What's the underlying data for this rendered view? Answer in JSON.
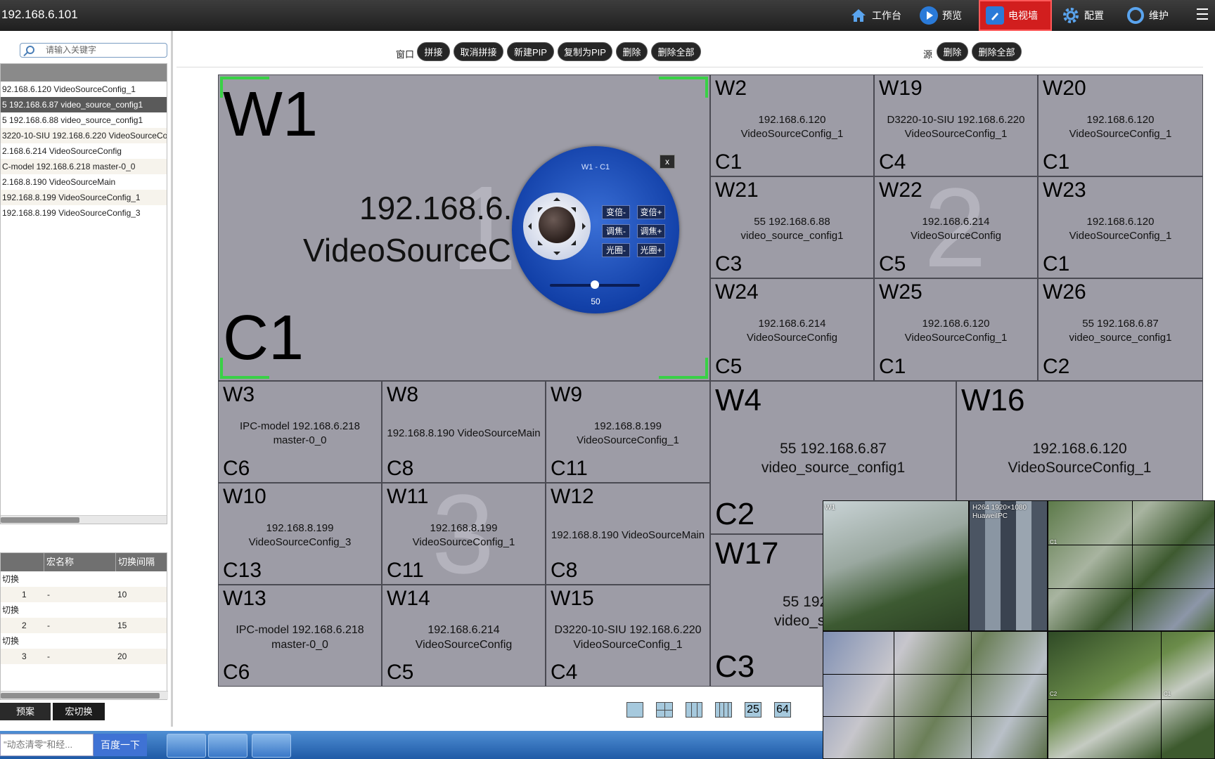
{
  "topbar": {
    "ip": "192.168.6.101",
    "nav": [
      {
        "label": "工作台",
        "icon": "home-icon"
      },
      {
        "label": "预览",
        "icon": "play-icon"
      },
      {
        "label": "电视墙",
        "icon": "tv-wall-icon",
        "active": true
      },
      {
        "label": "配置",
        "icon": "gear-icon"
      },
      {
        "label": "维护",
        "icon": "maintenance-icon"
      }
    ]
  },
  "search": {
    "placeholder": "请输入关键字"
  },
  "sources": [
    "92.168.6.120 VideoSourceConfig_1",
    "5 192.168.6.87 video_source_config1",
    "5 192.168.6.88 video_source_config1",
    "3220-10-SIU 192.168.6.220 VideoSourceCo",
    "2.168.6.214 VideoSourceConfig",
    "C-model 192.168.6.218 master-0_0",
    "2.168.8.190 VideoSourceMain",
    "192.168.8.199 VideoSourceConfig_1",
    "192.168.8.199 VideoSourceConfig_3"
  ],
  "macro": {
    "headers": [
      "宏名称",
      "切换间隔"
    ],
    "groups": [
      {
        "title": "切换",
        "no": "1",
        "name": "-",
        "interval": "10"
      },
      {
        "title": "切换",
        "no": "2",
        "name": "-",
        "interval": "15"
      },
      {
        "title": "切换",
        "no": "3",
        "name": "-",
        "interval": "20"
      }
    ],
    "tabs": [
      "预案",
      "宏切换"
    ]
  },
  "toolbar": {
    "window_label": "窗口",
    "window_buttons": [
      "拼接",
      "取消拼接",
      "新建PIP",
      "复制为PIP",
      "删除",
      "删除全部"
    ],
    "source_label": "源",
    "source_buttons": [
      "删除",
      "删除全部"
    ]
  },
  "windows": [
    {
      "id": "W1",
      "c": "C1",
      "src": [
        "192.168.6.",
        "VideoSourceC"
      ],
      "wm": "1"
    },
    {
      "id": "W2",
      "c": "C1",
      "src": [
        "192.168.6.120",
        "VideoSourceConfig_1"
      ]
    },
    {
      "id": "W19",
      "c": "C4",
      "src": [
        "D3220-10-SIU 192.168.6.220",
        "VideoSourceConfig_1"
      ]
    },
    {
      "id": "W20",
      "c": "C1",
      "src": [
        "192.168.6.120",
        "VideoSourceConfig_1"
      ]
    },
    {
      "id": "W21",
      "c": "C3",
      "src": [
        "55 192.168.6.88",
        "video_source_config1"
      ]
    },
    {
      "id": "W22",
      "c": "C5",
      "src": [
        "192.168.6.214",
        "VideoSourceConfig"
      ],
      "wm": "2"
    },
    {
      "id": "W23",
      "c": "C1",
      "src": [
        "192.168.6.120",
        "VideoSourceConfig_1"
      ]
    },
    {
      "id": "W24",
      "c": "C5",
      "src": [
        "192.168.6.214",
        "VideoSourceConfig"
      ]
    },
    {
      "id": "W25",
      "c": "C1",
      "src": [
        "192.168.6.120",
        "VideoSourceConfig_1"
      ]
    },
    {
      "id": "W26",
      "c": "C2",
      "src": [
        "55 192.168.6.87",
        "video_source_config1"
      ]
    },
    {
      "id": "W3",
      "c": "C6",
      "src": [
        "IPC-model 192.168.6.218",
        "master-0_0"
      ]
    },
    {
      "id": "W8",
      "c": "C8",
      "src": [
        "192.168.8.190 VideoSourceMain"
      ]
    },
    {
      "id": "W9",
      "c": "C11",
      "src": [
        "192.168.8.199",
        "VideoSourceConfig_1"
      ]
    },
    {
      "id": "W10",
      "c": "C13",
      "src": [
        "192.168.8.199",
        "VideoSourceConfig_3"
      ]
    },
    {
      "id": "W11",
      "c": "C11",
      "src": [
        "192.168.8.199",
        "VideoSourceConfig_1"
      ],
      "wm": "3"
    },
    {
      "id": "W12",
      "c": "C8",
      "src": [
        "192.168.8.190 VideoSourceMain"
      ]
    },
    {
      "id": "W13",
      "c": "C6",
      "src": [
        "IPC-model 192.168.6.218",
        "master-0_0"
      ]
    },
    {
      "id": "W14",
      "c": "C5",
      "src": [
        "192.168.6.214",
        "VideoSourceConfig"
      ]
    },
    {
      "id": "W15",
      "c": "C4",
      "src": [
        "D3220-10-SIU 192.168.6.220",
        "VideoSourceConfig_1"
      ]
    },
    {
      "id": "W4",
      "c": "C2",
      "src": [
        "55 192.168.6.87",
        "video_source_config1"
      ]
    },
    {
      "id": "W16",
      "c": "",
      "src": [
        "192.168.6.120",
        "VideoSourceConfig_1"
      ]
    },
    {
      "id": "W17",
      "c": "C3",
      "src": [
        "55 192",
        "video_sou"
      ]
    }
  ],
  "ptz": {
    "title": "W1 - C1",
    "buttons": [
      "变倍-",
      "变倍+",
      "调焦-",
      "调焦+",
      "光圈-",
      "光圈+"
    ],
    "close": "x",
    "level": 50,
    "level_label": "50"
  },
  "layouts": [
    "",
    "",
    "",
    "",
    "25",
    "64"
  ],
  "mosaic": {
    "labels": [
      "W1",
      "H264 1920×1080",
      "HuaweiIPC",
      "C1"
    ]
  },
  "taskbar": {
    "search_text": "\"动态清零\"和经...",
    "search_button": "百度一下"
  },
  "colors": {
    "active_nav": "#d21e1e",
    "window_fill": "#9d9ca6",
    "select_corner": "#39d146",
    "ptz_blue": "#1240a8"
  }
}
